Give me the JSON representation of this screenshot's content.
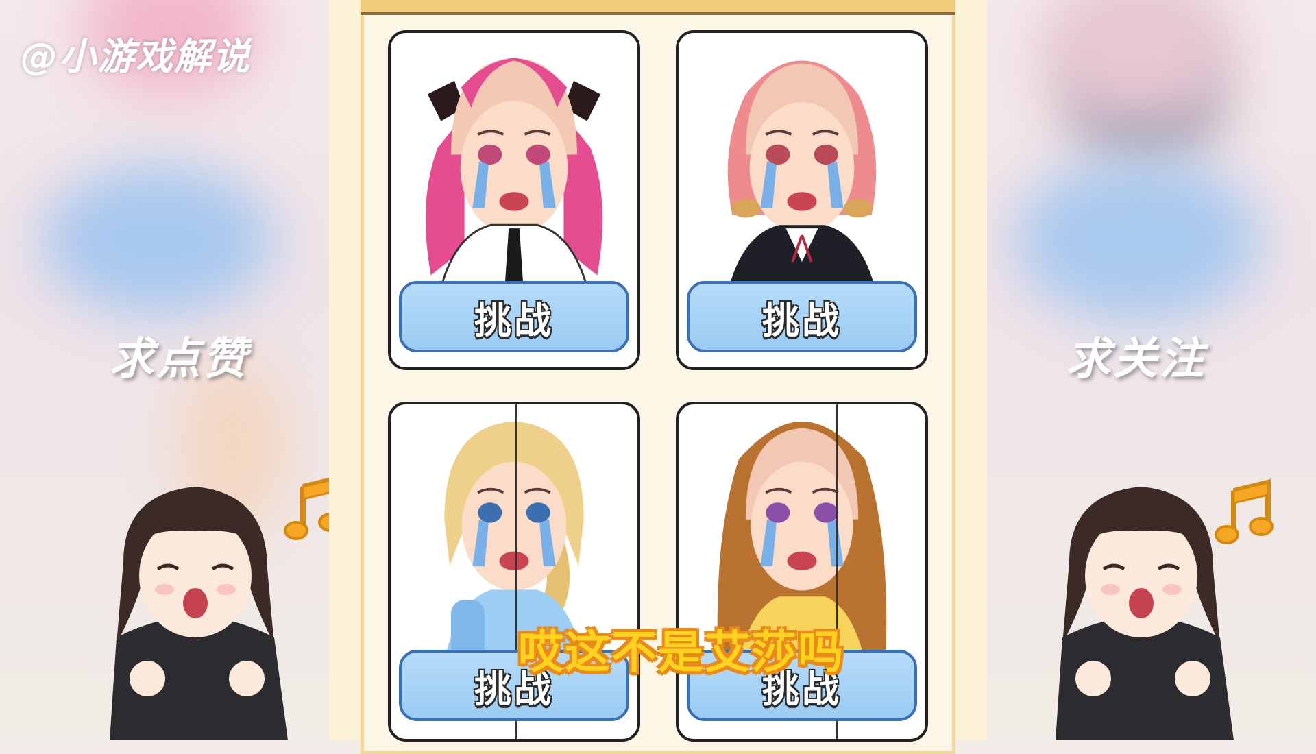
{
  "overlay": {
    "watermark": "@小游戏解说",
    "left_caption": "求点赞",
    "right_caption": "求关注",
    "subtitle": "哎这不是艾莎吗"
  },
  "cards": [
    {
      "button_label": "挑战"
    },
    {
      "button_label": "挑战"
    },
    {
      "button_label": "挑战"
    },
    {
      "button_label": "挑战"
    }
  ],
  "colors": {
    "panel_bg": "#fcf6e6",
    "button_fill": "#a9d3f5",
    "button_border": "#3a70b4",
    "subtitle_fill": "#ffd21f",
    "subtitle_stroke": "#e98a1a",
    "music_note": "#f5a623"
  }
}
